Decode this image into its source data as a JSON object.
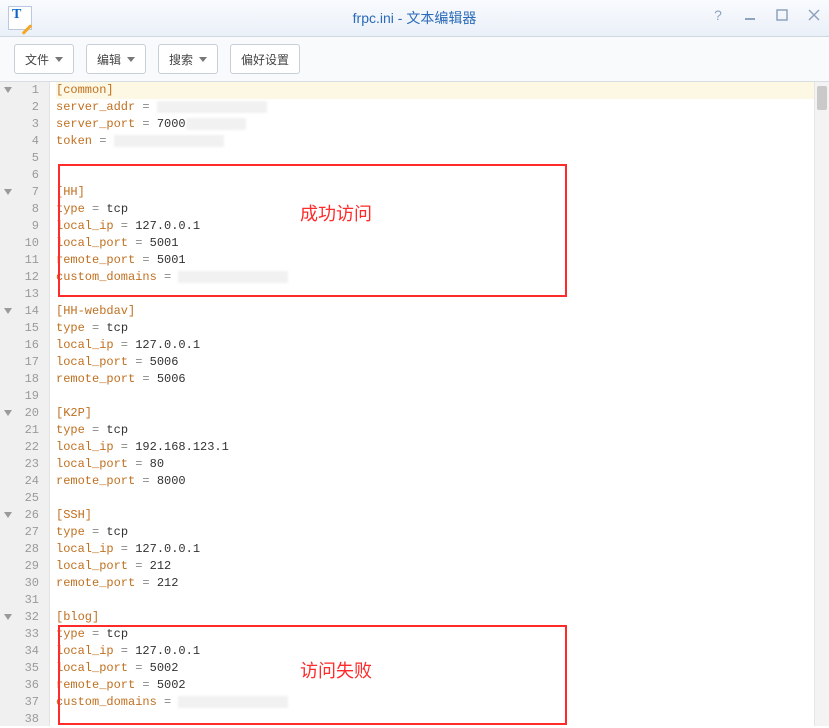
{
  "title": {
    "filename": "frpc.ini",
    "sep": " - ",
    "appname": "文本编辑器"
  },
  "menu": {
    "file": "文件",
    "edit": "编辑",
    "search": "搜索",
    "prefs": "偏好设置"
  },
  "annotations": {
    "success": "成功访问",
    "fail": "访问失败"
  },
  "fold_lines": [
    1,
    7,
    14,
    20,
    26,
    32
  ],
  "highlight_line": 1,
  "lines": [
    {
      "n": 1,
      "tokens": [
        {
          "t": "[common]",
          "c": "kw"
        }
      ]
    },
    {
      "n": 2,
      "tokens": [
        {
          "t": "server_addr",
          "c": "key"
        },
        {
          "t": " = ",
          "c": "op"
        },
        {
          "t": "",
          "redact": "lg"
        }
      ]
    },
    {
      "n": 3,
      "tokens": [
        {
          "t": "server_port",
          "c": "key"
        },
        {
          "t": " = ",
          "c": "op"
        },
        {
          "t": "7000"
        },
        {
          "t": "",
          "redact": ""
        }
      ]
    },
    {
      "n": 4,
      "tokens": [
        {
          "t": "token",
          "c": "key"
        },
        {
          "t": " = ",
          "c": "op"
        },
        {
          "t": "",
          "redact": "lg"
        }
      ]
    },
    {
      "n": 5,
      "tokens": []
    },
    {
      "n": 6,
      "tokens": []
    },
    {
      "n": 7,
      "tokens": [
        {
          "t": "[HH]",
          "c": "kw"
        }
      ]
    },
    {
      "n": 8,
      "tokens": [
        {
          "t": "type",
          "c": "key"
        },
        {
          "t": " = ",
          "c": "op"
        },
        {
          "t": "tcp"
        }
      ]
    },
    {
      "n": 9,
      "tokens": [
        {
          "t": "local_ip",
          "c": "key"
        },
        {
          "t": " = ",
          "c": "op"
        },
        {
          "t": "127.0.0.1"
        }
      ]
    },
    {
      "n": 10,
      "tokens": [
        {
          "t": "local_port",
          "c": "key"
        },
        {
          "t": " = ",
          "c": "op"
        },
        {
          "t": "5001"
        }
      ]
    },
    {
      "n": 11,
      "tokens": [
        {
          "t": "remote_port",
          "c": "key"
        },
        {
          "t": " = ",
          "c": "op"
        },
        {
          "t": "5001"
        }
      ]
    },
    {
      "n": 12,
      "tokens": [
        {
          "t": "custom_domains",
          "c": "key"
        },
        {
          "t": " = ",
          "c": "op"
        },
        {
          "t": "",
          "redact": "lg"
        }
      ]
    },
    {
      "n": 13,
      "tokens": []
    },
    {
      "n": 14,
      "tokens": [
        {
          "t": "[HH-webdav]",
          "c": "kw"
        }
      ]
    },
    {
      "n": 15,
      "tokens": [
        {
          "t": "type",
          "c": "key"
        },
        {
          "t": " = ",
          "c": "op"
        },
        {
          "t": "tcp"
        }
      ]
    },
    {
      "n": 16,
      "tokens": [
        {
          "t": "local_ip",
          "c": "key"
        },
        {
          "t": " = ",
          "c": "op"
        },
        {
          "t": "127.0.0.1"
        }
      ]
    },
    {
      "n": 17,
      "tokens": [
        {
          "t": "local_port",
          "c": "key"
        },
        {
          "t": " = ",
          "c": "op"
        },
        {
          "t": "5006"
        }
      ]
    },
    {
      "n": 18,
      "tokens": [
        {
          "t": "remote_port",
          "c": "key"
        },
        {
          "t": " = ",
          "c": "op"
        },
        {
          "t": "5006"
        }
      ]
    },
    {
      "n": 19,
      "tokens": []
    },
    {
      "n": 20,
      "tokens": [
        {
          "t": "[K2P]",
          "c": "kw"
        }
      ]
    },
    {
      "n": 21,
      "tokens": [
        {
          "t": "type",
          "c": "key"
        },
        {
          "t": " = ",
          "c": "op"
        },
        {
          "t": "tcp"
        }
      ]
    },
    {
      "n": 22,
      "tokens": [
        {
          "t": "local_ip",
          "c": "key"
        },
        {
          "t": " = ",
          "c": "op"
        },
        {
          "t": "192.168.123.1"
        }
      ]
    },
    {
      "n": 23,
      "tokens": [
        {
          "t": "local_port",
          "c": "key"
        },
        {
          "t": " = ",
          "c": "op"
        },
        {
          "t": "80"
        }
      ]
    },
    {
      "n": 24,
      "tokens": [
        {
          "t": "remote_port",
          "c": "key"
        },
        {
          "t": " = ",
          "c": "op"
        },
        {
          "t": "8000"
        }
      ]
    },
    {
      "n": 25,
      "tokens": []
    },
    {
      "n": 26,
      "tokens": [
        {
          "t": "[SSH]",
          "c": "kw"
        }
      ]
    },
    {
      "n": 27,
      "tokens": [
        {
          "t": "type",
          "c": "key"
        },
        {
          "t": " = ",
          "c": "op"
        },
        {
          "t": "tcp"
        }
      ]
    },
    {
      "n": 28,
      "tokens": [
        {
          "t": "local_ip",
          "c": "key"
        },
        {
          "t": " = ",
          "c": "op"
        },
        {
          "t": "127.0.0.1"
        }
      ]
    },
    {
      "n": 29,
      "tokens": [
        {
          "t": "local_port",
          "c": "key"
        },
        {
          "t": " = ",
          "c": "op"
        },
        {
          "t": "212"
        }
      ]
    },
    {
      "n": 30,
      "tokens": [
        {
          "t": "remote_port",
          "c": "key"
        },
        {
          "t": " = ",
          "c": "op"
        },
        {
          "t": "212"
        }
      ]
    },
    {
      "n": 31,
      "tokens": []
    },
    {
      "n": 32,
      "tokens": [
        {
          "t": "[blog]",
          "c": "kw"
        }
      ]
    },
    {
      "n": 33,
      "tokens": [
        {
          "t": "type",
          "c": "key"
        },
        {
          "t": " = ",
          "c": "op"
        },
        {
          "t": "tcp"
        }
      ]
    },
    {
      "n": 34,
      "tokens": [
        {
          "t": "local_ip",
          "c": "key"
        },
        {
          "t": " = ",
          "c": "op"
        },
        {
          "t": "127.0.0.1"
        }
      ]
    },
    {
      "n": 35,
      "tokens": [
        {
          "t": "local_port",
          "c": "key"
        },
        {
          "t": " = ",
          "c": "op"
        },
        {
          "t": "5002"
        }
      ]
    },
    {
      "n": 36,
      "tokens": [
        {
          "t": "remote_port",
          "c": "key"
        },
        {
          "t": " = ",
          "c": "op"
        },
        {
          "t": "5002"
        }
      ]
    },
    {
      "n": 37,
      "tokens": [
        {
          "t": "custom_domains",
          "c": "key"
        },
        {
          "t": " = ",
          "c": "op"
        },
        {
          "t": "",
          "redact": "lg"
        }
      ]
    },
    {
      "n": 38,
      "tokens": []
    }
  ]
}
